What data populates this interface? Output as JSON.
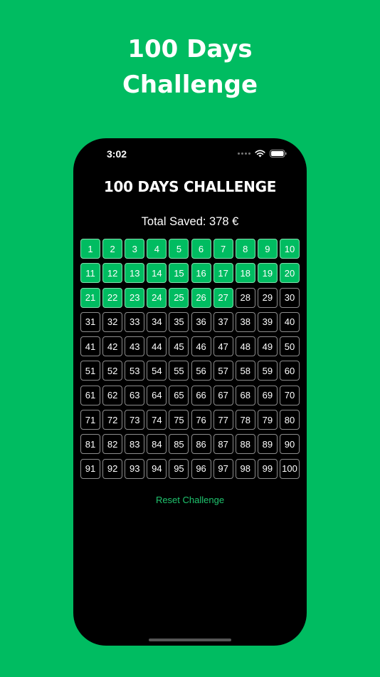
{
  "promo": {
    "headline_line1": "100 Days",
    "headline_line2": "Challenge"
  },
  "status_bar": {
    "time": "3:02",
    "wifi_icon": "wifi-icon",
    "battery_icon": "battery-icon"
  },
  "app": {
    "title": "100 DAYS CHALLENGE",
    "total_saved": "Total Saved: 378 €",
    "reset_label": "Reset Challenge",
    "accent_color": "#00BC61"
  },
  "days": {
    "total": 100,
    "completed": [
      1,
      2,
      3,
      4,
      5,
      6,
      7,
      8,
      9,
      10,
      11,
      12,
      13,
      14,
      15,
      16,
      17,
      18,
      19,
      20,
      21,
      22,
      23,
      24,
      25,
      26,
      27
    ]
  }
}
